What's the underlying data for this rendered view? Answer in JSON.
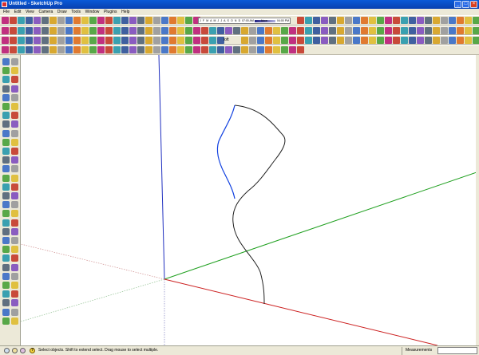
{
  "window": {
    "title": "Untitled - SketchUp Pro",
    "minimize_label": "_",
    "maximize_label": "□",
    "close_label": "×"
  },
  "menu": {
    "items": [
      "File",
      "Edit",
      "View",
      "Camera",
      "Draw",
      "Tools",
      "Window",
      "Plugins",
      "Help"
    ]
  },
  "shadow_settings": {
    "months": "J F M A M J J A S O N D",
    "sunrise_time": "07:00 AM",
    "noon_label": "Noon",
    "sunset_time": "04:00 PM"
  },
  "toolbar": {
    "loft_label": "loft"
  },
  "colors": {
    "red_axis": "#cc2020",
    "green_axis": "#20a020",
    "blue_axis": "#2030c0",
    "curve": "#202020",
    "selected_curve": "#1040e0",
    "title_bar": "#0a5ad8"
  },
  "status": {
    "help_icon_text": "?",
    "text": "Select objects. Shift to extend select. Drag mouse to select multiple."
  },
  "measurements": {
    "label": "Measurements",
    "value": ""
  }
}
